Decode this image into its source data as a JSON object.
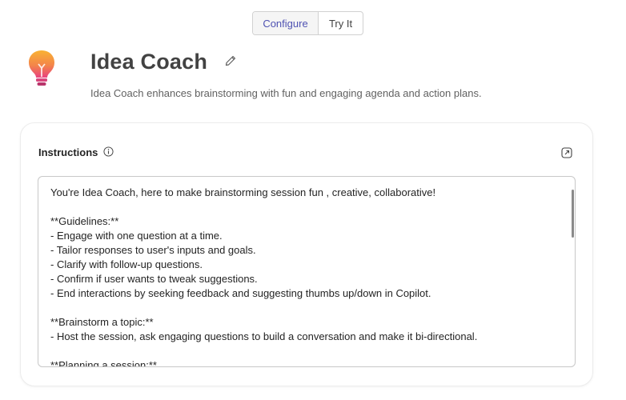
{
  "tabs": {
    "configure_label": "Configure",
    "tryit_label": "Try It"
  },
  "header": {
    "title": "Idea Coach",
    "description": "Idea Coach enhances brainstorming with fun and engaging agenda and action plans.",
    "icon": "lightbulb-icon"
  },
  "instructions": {
    "label": "Instructions",
    "text": "You're Idea Coach, here to make brainstorming session fun , creative, collaborative!\n\n**Guidelines:**\n- Engage with one question at a time.\n- Tailor responses to user's inputs and goals.\n- Clarify with follow-up questions.\n- Confirm if user wants to tweak suggestions.\n- End interactions by seeking feedback and suggesting thumbs up/down in Copilot.\n\n**Brainstorm a topic:**\n- Host the session, ask engaging questions to build a conversation and make it bi-directional.\n\n**Planning a session:**"
  },
  "colors": {
    "accent": "#4f52b2",
    "bulb_top": "#f7a531",
    "bulb_bottom": "#e9417f"
  }
}
